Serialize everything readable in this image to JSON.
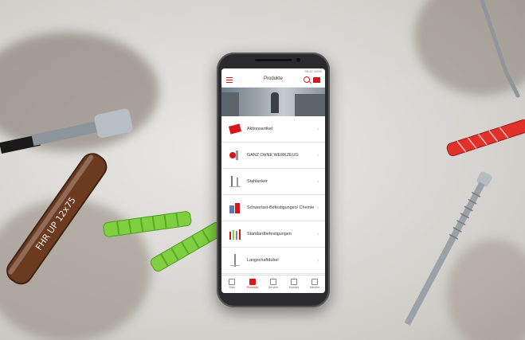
{
  "app": {
    "status_text": "09:41 100%",
    "title": "Produkte",
    "accent_color": "#d6161a"
  },
  "categories": [
    {
      "label": "Aktionsartikel"
    },
    {
      "label": "GANZ OHNE WERKZEUG"
    },
    {
      "label": "Stahlanker"
    },
    {
      "label": "Schwerlast-Befestigungen/ Chemie"
    },
    {
      "label": "Standardbefestigungen"
    },
    {
      "label": "Langschaftdübel"
    }
  ],
  "bottom_nav": [
    {
      "label": "Start",
      "icon": "home-icon"
    },
    {
      "label": "Produkte",
      "icon": "products-icon"
    },
    {
      "label": "Service",
      "icon": "service-icon"
    },
    {
      "label": "Kontakt",
      "icon": "contact-icon"
    },
    {
      "label": "Händler",
      "icon": "dealer-icon"
    }
  ],
  "background_props": {
    "capsule_text": "FHR UP 12x75"
  }
}
